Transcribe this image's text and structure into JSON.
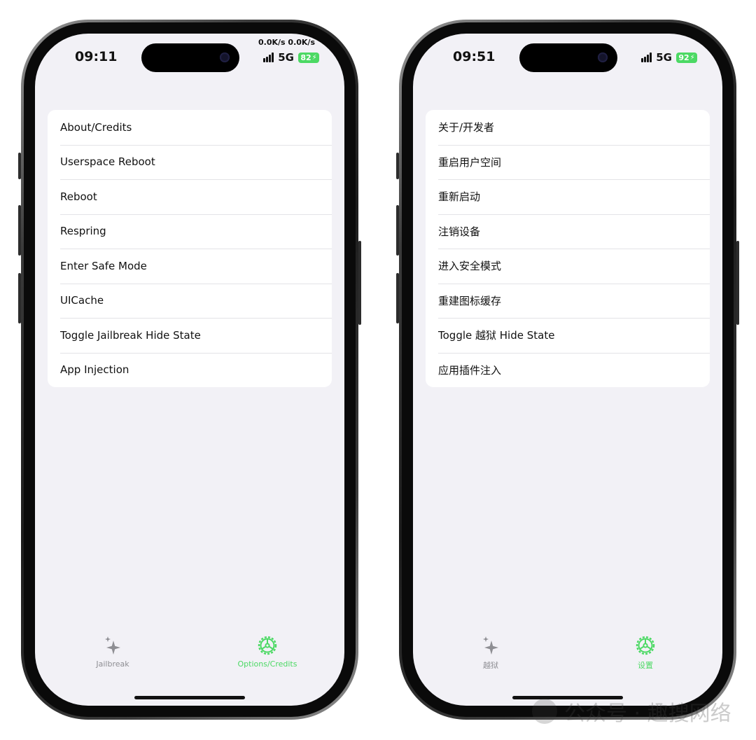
{
  "colors": {
    "accent_green": "#4cd964",
    "inactive_gray": "#8e8e93",
    "background": "#f2f1f6"
  },
  "phones": [
    {
      "status": {
        "time": "09:11",
        "network_speed": "0.0K/s 0.0K/s",
        "network": "5G",
        "battery": "82"
      },
      "menu": [
        "About/Credits",
        "Userspace Reboot",
        "Reboot",
        "Respring",
        "Enter Safe Mode",
        "UICache",
        "Toggle Jailbreak Hide State",
        "App Injection"
      ],
      "tabs": [
        {
          "label": "Jailbreak",
          "icon": "sparkles-icon",
          "active": false
        },
        {
          "label": "Options/Credits",
          "icon": "gear-icon",
          "active": true
        }
      ]
    },
    {
      "status": {
        "time": "09:51",
        "network": "5G",
        "battery": "92"
      },
      "menu": [
        "关于/开发者",
        "重启用户空间",
        "重新启动",
        "注销设备",
        "进入安全模式",
        "重建图标缓存",
        "Toggle 越狱 Hide State",
        "应用插件注入"
      ],
      "tabs": [
        {
          "label": "越狱",
          "icon": "sparkles-icon",
          "active": false
        },
        {
          "label": "设置",
          "icon": "gear-icon",
          "active": true
        }
      ]
    }
  ],
  "watermark": {
    "text": "公众号 · 趣搜网络"
  }
}
